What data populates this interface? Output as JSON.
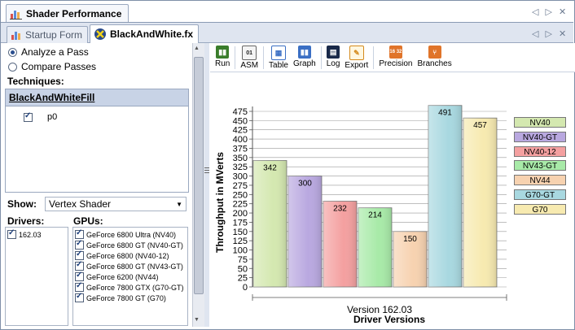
{
  "window": {
    "title": "Shader Performance",
    "controls": [
      "◁",
      "▷",
      "✕"
    ]
  },
  "doc_tabs": [
    {
      "label": "Startup Form",
      "active": false
    },
    {
      "label": "BlackAndWhite.fx",
      "active": true
    }
  ],
  "left": {
    "mode_options": [
      {
        "label": "Analyze a Pass",
        "selected": true
      },
      {
        "label": "Compare Passes",
        "selected": false
      }
    ],
    "techniques_label": "Techniques:",
    "technique_name": "BlackAndWhiteFill",
    "passes": [
      {
        "label": "p0",
        "checked": true
      }
    ],
    "show_label": "Show:",
    "show_value": "Vertex Shader",
    "drivers_label": "Drivers:",
    "drivers": [
      {
        "label": "162.03",
        "checked": true
      }
    ],
    "gpus_label": "GPUs:",
    "gpus": [
      {
        "label": "GeForce 6800 Ultra (NV40)",
        "checked": true
      },
      {
        "label": "GeForce 6800 GT (NV40-GT)",
        "checked": true
      },
      {
        "label": "GeForce 6800 (NV40-12)",
        "checked": true
      },
      {
        "label": "GeForce 6800 GT (NV43-GT)",
        "checked": true
      },
      {
        "label": "GeForce 6200 (NV44)",
        "checked": true
      },
      {
        "label": "GeForce 7800 GTX (G70-GT)",
        "checked": true
      },
      {
        "label": "GeForce 7800 GT (G70)",
        "checked": true
      }
    ]
  },
  "toolbar": {
    "buttons": [
      {
        "label": "Run",
        "icon": "run-icon",
        "color": "#3a7d2b"
      },
      {
        "label": "ASM",
        "icon": "asm-icon",
        "color": "#4a4a4a"
      },
      {
        "label": "Table",
        "icon": "table-icon",
        "color": "#3b6fc4"
      },
      {
        "label": "Graph",
        "icon": "graph-icon",
        "color": "#3b6fc4"
      },
      {
        "label": "Log",
        "icon": "log-icon",
        "color": "#1a2a4a"
      },
      {
        "label": "Export",
        "icon": "export-icon",
        "color": "#d48a1c"
      },
      {
        "label": "Precision",
        "icon": "precision-icon",
        "color": "#e0742a"
      },
      {
        "label": "Branches",
        "icon": "branches-icon",
        "color": "#e0742a"
      }
    ]
  },
  "chart_data": {
    "type": "bar",
    "ylabel": "Throughput in MVerts",
    "xlabel": "Driver Versions",
    "category": "Version 162.03",
    "ylim": [
      0,
      475
    ],
    "yticks": [
      0,
      25,
      50,
      75,
      100,
      125,
      150,
      175,
      200,
      225,
      250,
      275,
      300,
      325,
      350,
      375,
      400,
      425,
      450,
      475
    ],
    "series": [
      {
        "name": "NV40",
        "value": 342,
        "color": "#d4e8b0"
      },
      {
        "name": "NV40-GT",
        "value": 300,
        "color": "#b9a8e0"
      },
      {
        "name": "NV40-12",
        "value": 232,
        "color": "#f4a0a0"
      },
      {
        "name": "NV43-GT",
        "value": 214,
        "color": "#a8eaa8"
      },
      {
        "name": "NV44",
        "value": 150,
        "color": "#f7d2b0"
      },
      {
        "name": "G70-GT",
        "value": 491,
        "color": "#a8d8e0"
      },
      {
        "name": "G70",
        "value": 457,
        "color": "#f7eab0"
      }
    ],
    "legend": "right",
    "grid": true
  }
}
